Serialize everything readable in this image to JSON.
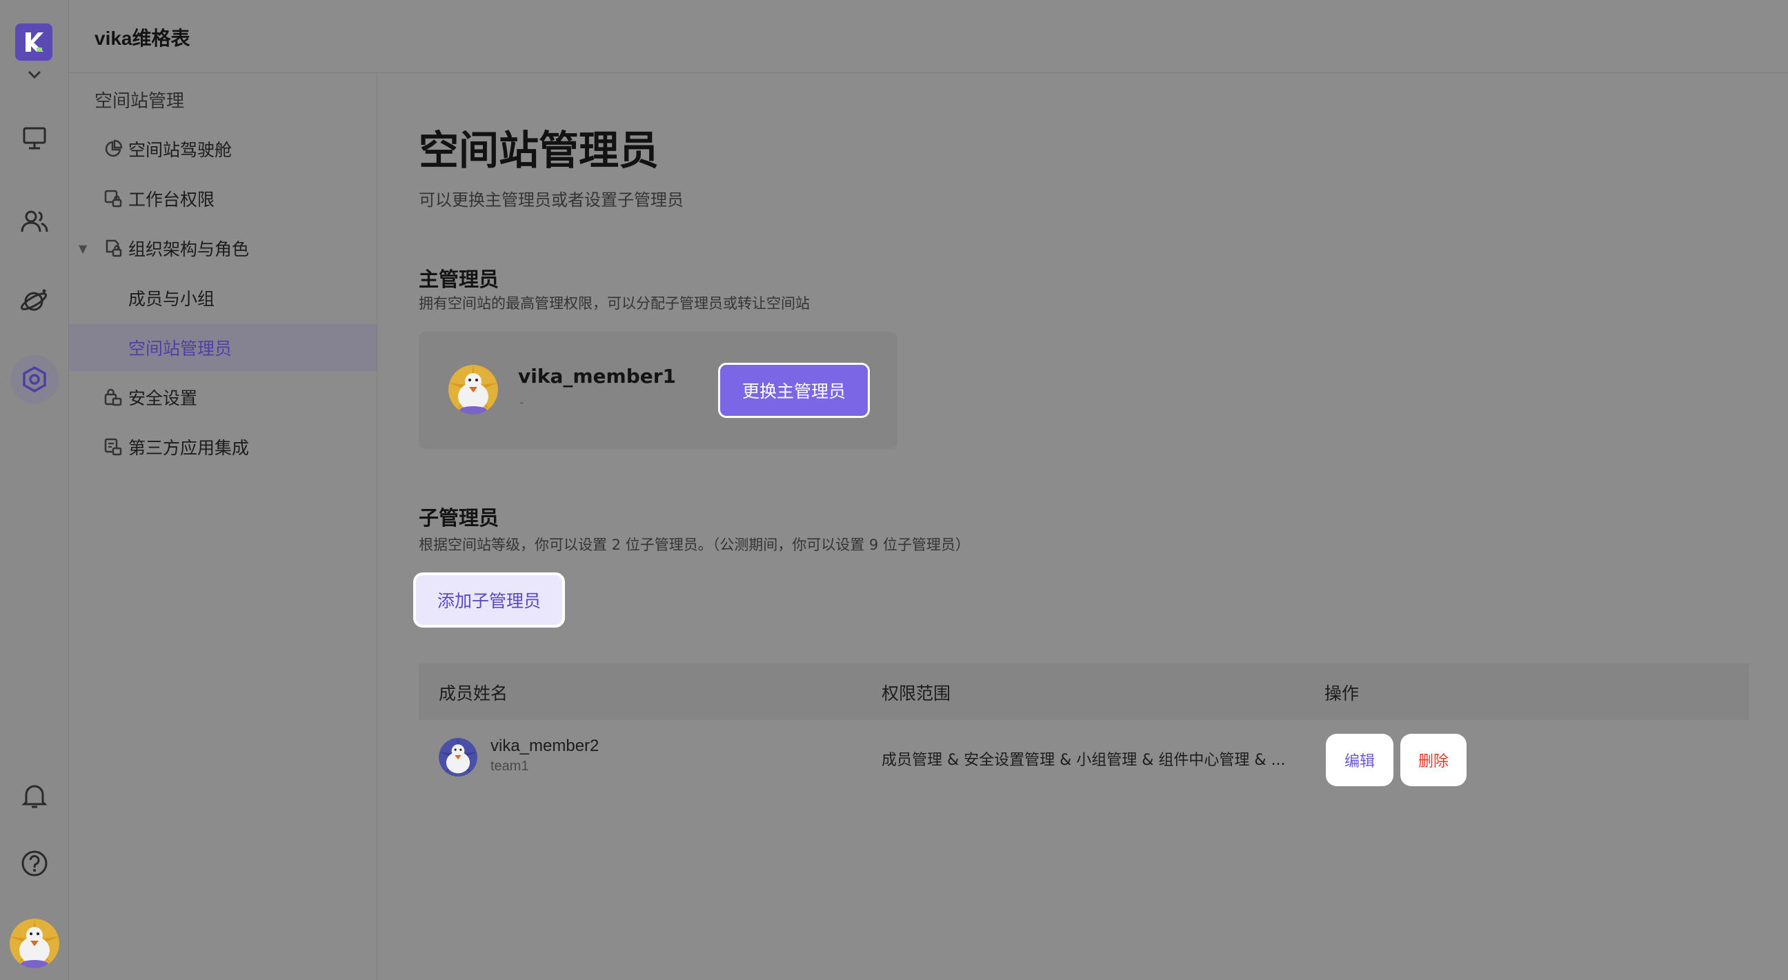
{
  "app": {
    "title": "vika维格表"
  },
  "colors": {
    "brand": "#7b67e6",
    "danger": "#e0392b",
    "selected_text": "#4d3fa6"
  },
  "rail": {
    "icons": [
      "logo-icon",
      "chevron-down-icon",
      "monitor-icon",
      "users-icon",
      "planet-icon",
      "settings-hex-icon",
      "bell-icon",
      "help-icon"
    ]
  },
  "sidebar": {
    "group_label": "空间站管理",
    "items": [
      {
        "label": "空间站驾驶舱",
        "icon": "pie-chart-icon"
      },
      {
        "label": "工作台权限",
        "icon": "workbench-lock-icon"
      },
      {
        "label": "组织架构与角色",
        "icon": "org-lock-icon"
      },
      {
        "label": "成员与小组"
      },
      {
        "label": "空间站管理员"
      },
      {
        "label": "安全设置",
        "icon": "security-lock-icon"
      },
      {
        "label": "第三方应用集成",
        "icon": "integration-lock-icon"
      }
    ]
  },
  "main": {
    "title": "空间站管理员",
    "subtitle": "可以更换主管理员或者设置子管理员",
    "owner_section": {
      "title": "主管理员",
      "desc": "拥有空间站的最高管理权限，可以分配子管理员或转让空间站",
      "member_name": "vika_member1",
      "member_team": "-",
      "change_button": "更换主管理员"
    },
    "sub_section": {
      "title": "子管理员",
      "desc": "根据空间站等级，你可以设置 2 位子管理员。（公测期间，你可以设置 9 位子管理员）",
      "add_button": "添加子管理员",
      "columns": [
        "成员姓名",
        "权限范围",
        "操作"
      ],
      "rows": [
        {
          "name": "vika_member2",
          "team": "team1",
          "permissions": "成员管理 & 安全设置管理 & 小组管理 & 组件中心管理 & ...",
          "edit": "编辑",
          "delete": "删除"
        }
      ]
    }
  }
}
